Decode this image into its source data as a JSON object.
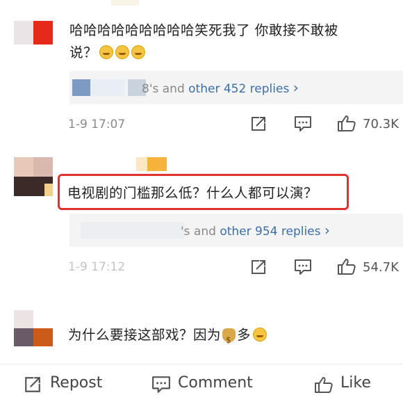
{
  "comments": [
    {
      "text_line1": "哈哈哈哈哈哈哈哈哈笑死我了 你敢接不敢被",
      "text_line2": "说？",
      "replies_suffix": "8's and",
      "replies_link": "other 452 replies",
      "chevron": "›",
      "time": "1-9 17:07",
      "likes": "70.3K"
    },
    {
      "text": "电视剧的门槛那么低？什么人都可以演？",
      "replies_suffix": "'s and",
      "replies_link": "other 954 replies",
      "chevron": "›",
      "time": "1-9 17:12",
      "likes": "54.7K"
    },
    {
      "text_a": "为什么要接这部戏？因为",
      "text_b": "多"
    }
  ],
  "bottom_bar": {
    "repost": "Repost",
    "comment": "Comment",
    "like": "Like"
  },
  "colors": {
    "highlight_border": "#e3312d",
    "link": "#3b6ea8"
  },
  "icons": [
    "share-icon",
    "comment-icon",
    "thumbs-up-icon",
    "laughing-emoji-icon",
    "money-bag-emoji-icon"
  ]
}
